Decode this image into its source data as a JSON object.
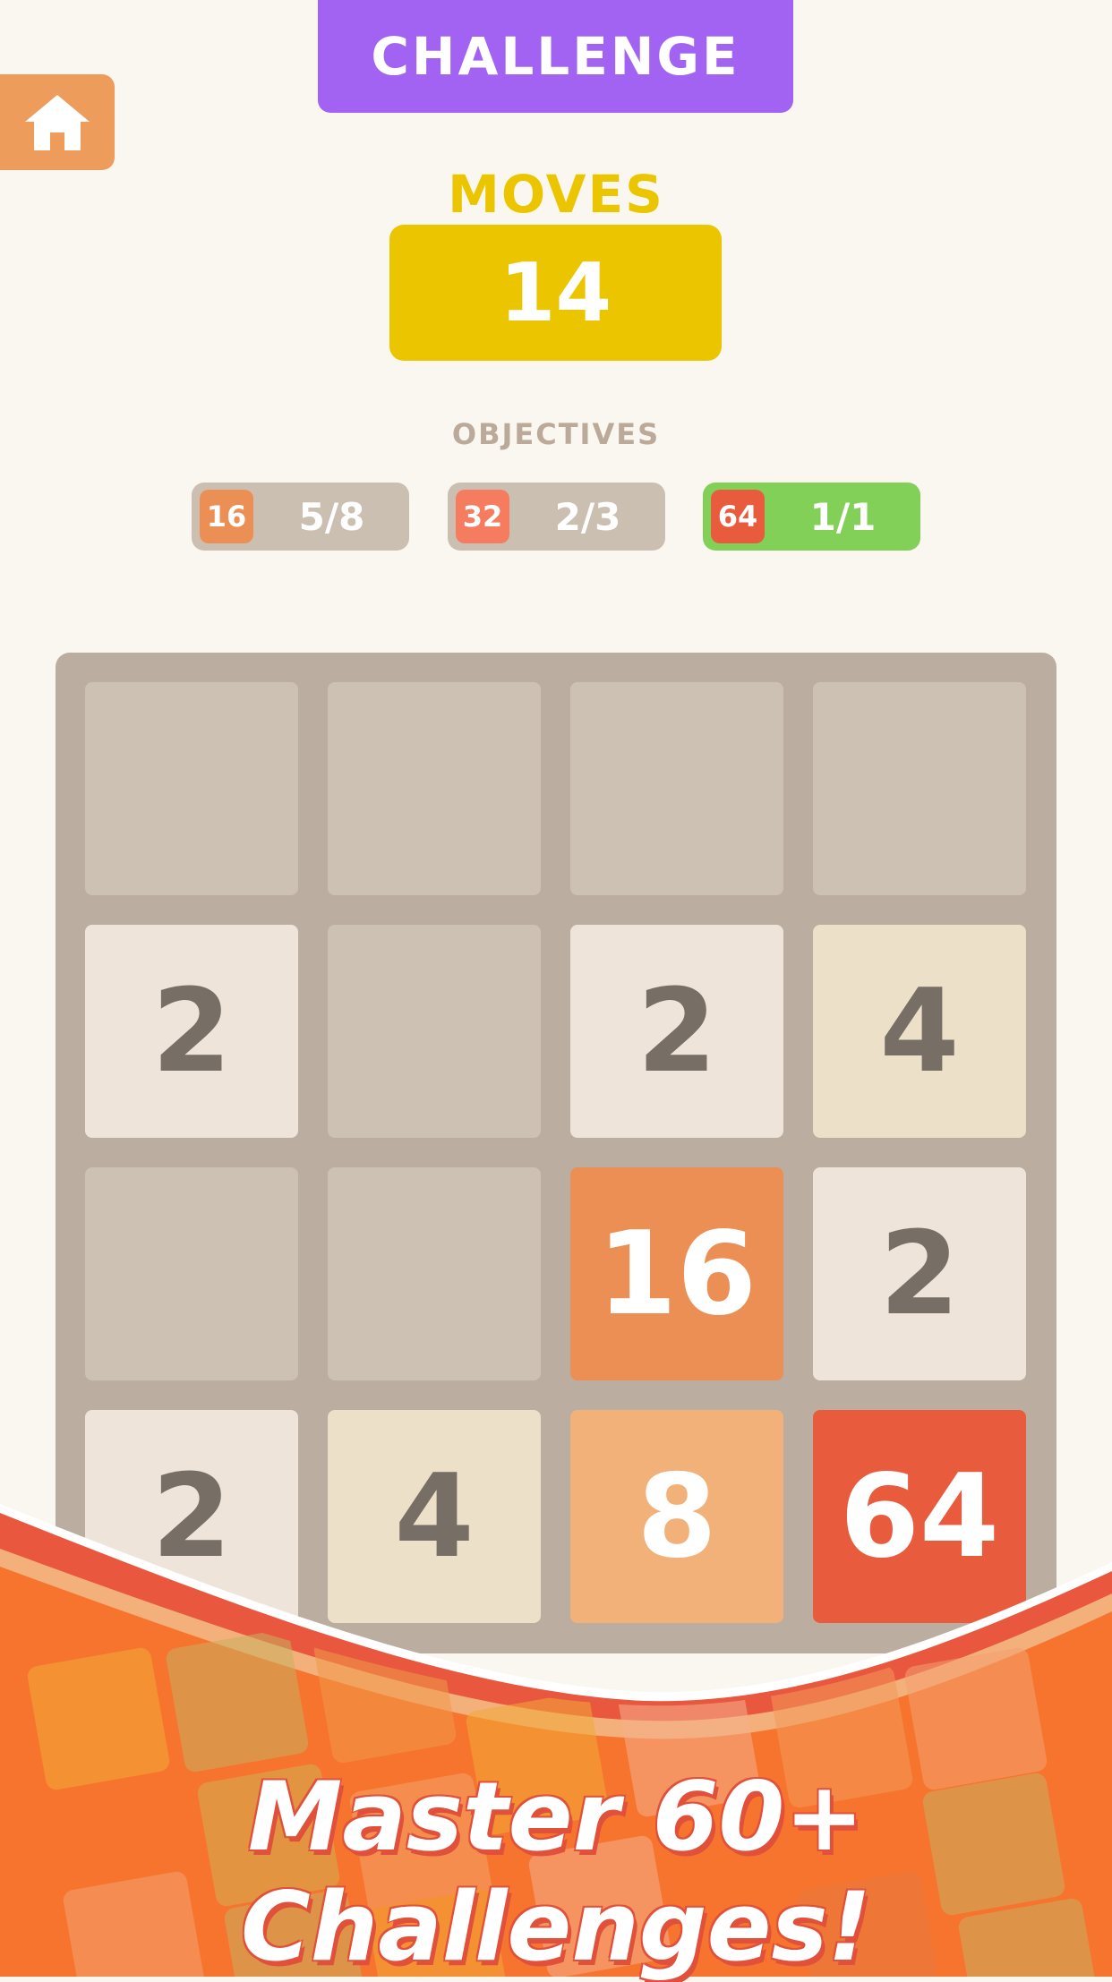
{
  "header": {
    "challenge_label": "CHALLENGE",
    "home_icon": "home-icon"
  },
  "moves": {
    "label": "MOVES",
    "value": "14"
  },
  "objectives": {
    "label": "OBJECTIVES",
    "items": [
      {
        "tile": "16",
        "progress": "5/8",
        "tile_color": "#ec8f54",
        "completed": false
      },
      {
        "tile": "32",
        "progress": "2/3",
        "tile_color": "#f67c5f",
        "completed": false
      },
      {
        "tile": "64",
        "progress": "1/1",
        "tile_color": "#e85b3d",
        "completed": true
      }
    ]
  },
  "board": {
    "rows": [
      [
        "",
        "",
        "",
        ""
      ],
      [
        "2",
        "",
        "2",
        "4"
      ],
      [
        "",
        "",
        "16",
        "2"
      ],
      [
        "2",
        "4",
        "8",
        "64"
      ]
    ]
  },
  "banner": {
    "text": "Master 60+ Challenges!"
  },
  "colors": {
    "challenge": "#a263f2",
    "moves": "#ebc600",
    "objective_done": "#83d058",
    "banner_orange": "#f6742e"
  }
}
